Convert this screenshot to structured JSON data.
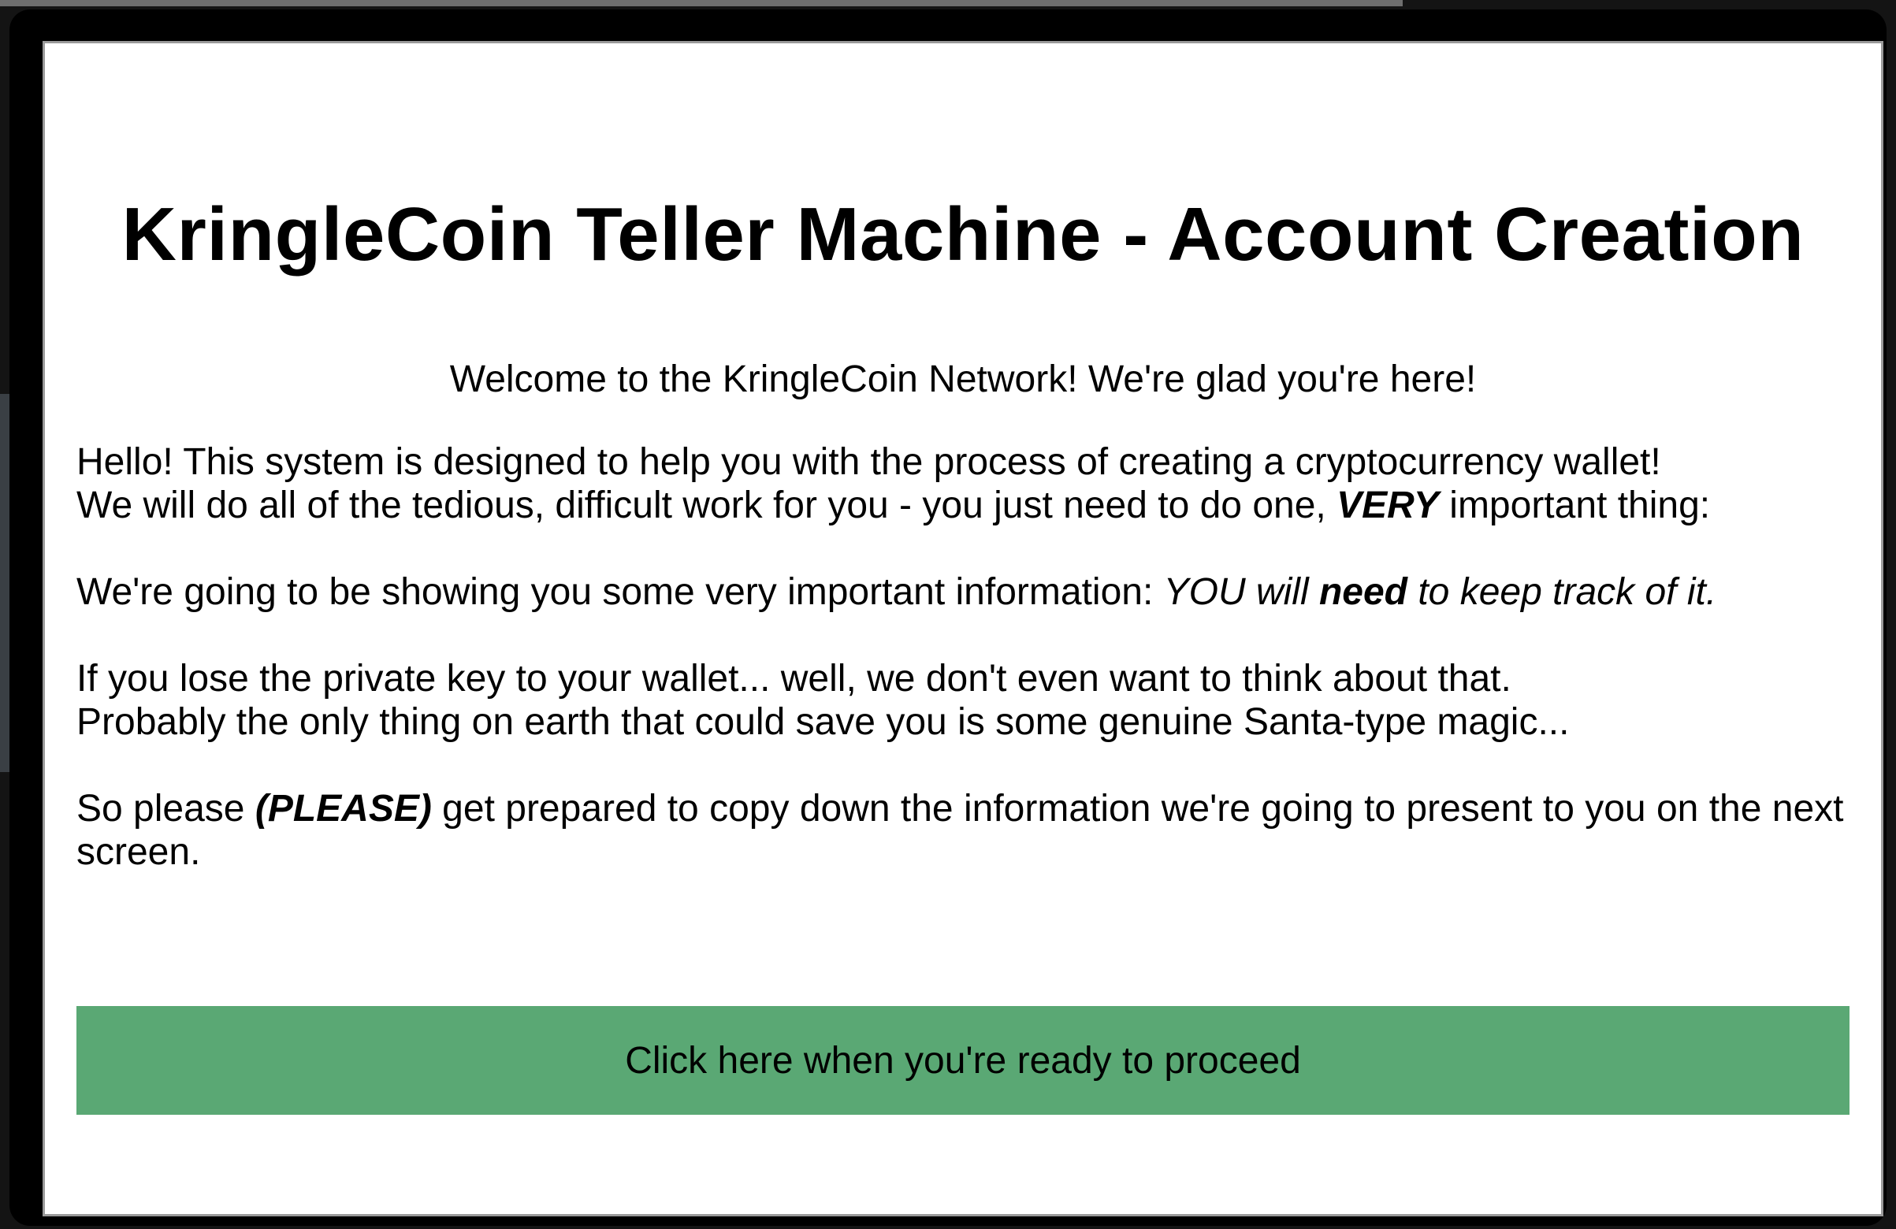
{
  "page": {
    "title": "KringleCoin Teller Machine - Account Creation",
    "welcome": "Welcome to the KringleCoin Network! We're glad you're here!",
    "intro": {
      "line1": "Hello! This system is designed to help you with the process of creating a cryptocurrency wallet!",
      "line2_before": "We will do all of the tedious, difficult work for you - you just need to do one, ",
      "line2_emphasis": "VERY",
      "line2_after": " important thing:"
    },
    "info": {
      "before": "We're going to be showing you some very important information: ",
      "italic_before": "YOU will ",
      "italic_bold": "need",
      "italic_after": " to keep track of it."
    },
    "warning": {
      "line1": "If you lose the private key to your wallet... well, we don't even want to think about that.",
      "line2": "Probably the only thing on earth that could save you is some genuine Santa-type magic..."
    },
    "prepare": {
      "before": "So please ",
      "emphasis": "(PLEASE)",
      "after": " get prepared to copy down the information we're going to present to you on the next screen."
    },
    "proceed_label": "Click here when you're ready to proceed"
  },
  "colors": {
    "button": "#5aa874",
    "frame": "#000000",
    "screen": "#ffffff"
  }
}
